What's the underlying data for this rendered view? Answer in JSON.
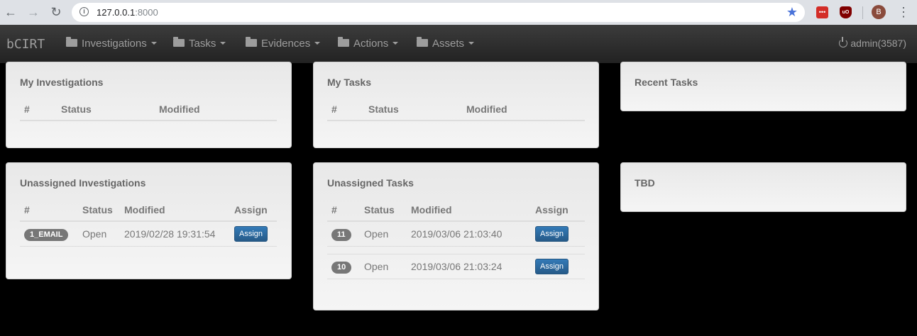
{
  "browser": {
    "url_host": "127.0.0.1",
    "url_port": ":8000",
    "profile_initial": "B",
    "icons": [
      "back-arrow-icon",
      "forward-arrow-icon",
      "reload-icon",
      "info-icon",
      "star-icon",
      "lastpass-icon",
      "ublock-icon",
      "kebab-menu-icon"
    ]
  },
  "navbar": {
    "brand": "bCIRT",
    "items": [
      {
        "label": "Investigations"
      },
      {
        "label": "Tasks"
      },
      {
        "label": "Evidences"
      },
      {
        "label": "Actions"
      },
      {
        "label": "Assets"
      }
    ],
    "user": "admin(3587)"
  },
  "panels": {
    "my_investigations": {
      "title": "My Investigations",
      "columns": [
        "#",
        "Status",
        "Modified"
      ]
    },
    "my_tasks": {
      "title": "My Tasks",
      "columns": [
        "#",
        "Status",
        "Modified"
      ]
    },
    "recent_tasks": {
      "title": "Recent Tasks"
    },
    "unassigned_investigations": {
      "title": "Unassigned Investigations",
      "columns": [
        "#",
        "Status",
        "Modified",
        "Assign"
      ],
      "rows": [
        {
          "id": "1_EMAIL",
          "status": "Open",
          "modified": "2019/02/28 19:31:54",
          "action": "Assign"
        }
      ]
    },
    "unassigned_tasks": {
      "title": "Unassigned Tasks",
      "columns": [
        "#",
        "Status",
        "Modified",
        "Assign"
      ],
      "rows": [
        {
          "id": "11",
          "status": "Open",
          "modified": "2019/03/06 21:03:40",
          "action": "Assign"
        },
        {
          "id": "10",
          "status": "Open",
          "modified": "2019/03/06 21:03:24",
          "action": "Assign"
        }
      ]
    },
    "tbd": {
      "title": "TBD"
    }
  },
  "colors": {
    "navbar": "#2b2b2b",
    "panel": "#eeeeee",
    "badge": "#777777",
    "assign_button": "#2e6da4"
  }
}
